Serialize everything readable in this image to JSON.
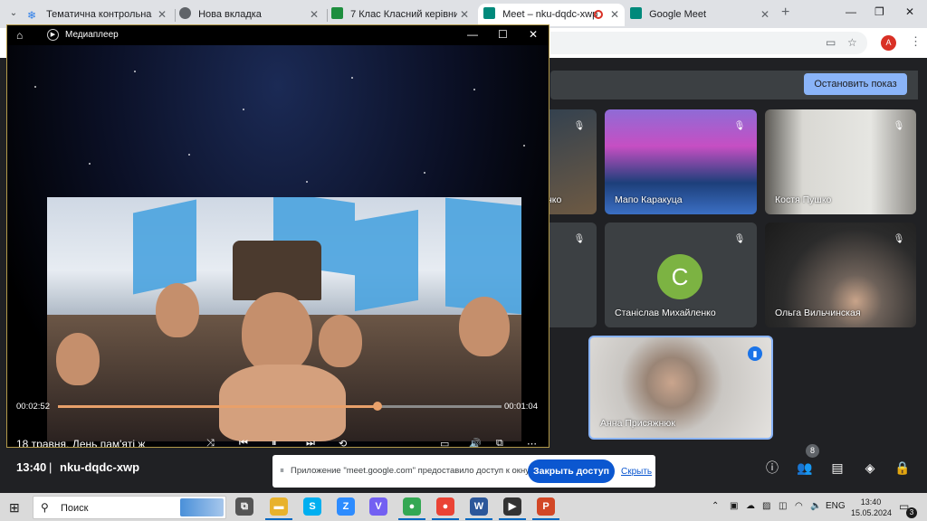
{
  "browser": {
    "tabs": [
      {
        "title": "Тематична контрольна робо",
        "favicon_color": "#2b7de9"
      },
      {
        "title": "Нова вкладка",
        "favicon_color": "#5f6368"
      },
      {
        "title": "7 Клас Класний керівник: О",
        "favicon_color": "#1e8e3e"
      },
      {
        "title": "Meet – nku-dqdc-xwp",
        "favicon_color": "#00897b"
      },
      {
        "title": "Google Meet",
        "favicon_color": "#00897b"
      }
    ],
    "profile_initial": "A",
    "new_tab": "+",
    "menu": "⋮"
  },
  "meet": {
    "stop_presenting": "Остановить показ",
    "participants": [
      {
        "name": "нко"
      },
      {
        "name": "Мапо Каракуца"
      },
      {
        "name": "Костя Пушко"
      },
      {
        "name": "Станіслав Михайленко",
        "initial": "C"
      },
      {
        "name": "Ольга Вильчинская"
      },
      {
        "name": "Анна Присяжнюк"
      }
    ],
    "clock": "13:40",
    "separator": "|",
    "code": "nku-dqdc-xwp",
    "people_count": "8",
    "share_notice": {
      "grip": "⏸",
      "message": "Приложение \"meet.google.com\" предоставило доступ к окну.",
      "stop_access": "Закрыть доступ",
      "hide": "Скрыть"
    }
  },
  "player": {
    "title": "Медиаплеер",
    "elapsed": "00:02:52",
    "remaining": "00:01:04",
    "progress": 0.72,
    "video_title": "18 травня. День пам'яті ж"
  },
  "taskbar": {
    "search_placeholder": "Поиск",
    "language": "ENG",
    "time": "13:40",
    "date": "15.05.2024",
    "notification_count": "3",
    "apps": [
      {
        "name": "task-view",
        "label": "⧉",
        "color": "#555555"
      },
      {
        "name": "file-explorer",
        "label": "▬",
        "color": "#e8b22c"
      },
      {
        "name": "skype",
        "label": "S",
        "color": "#00aff0"
      },
      {
        "name": "zoom",
        "label": "Z",
        "color": "#2d8cff"
      },
      {
        "name": "viber",
        "label": "V",
        "color": "#7360f2"
      },
      {
        "name": "chrome",
        "label": "●",
        "color": "#34a853"
      },
      {
        "name": "chrome-profile",
        "label": "●",
        "color": "#ea4335"
      },
      {
        "name": "word",
        "label": "W",
        "color": "#2b579a"
      },
      {
        "name": "media-player",
        "label": "▶",
        "color": "#333333"
      },
      {
        "name": "powerpoint",
        "label": "P",
        "color": "#d24726"
      }
    ]
  }
}
